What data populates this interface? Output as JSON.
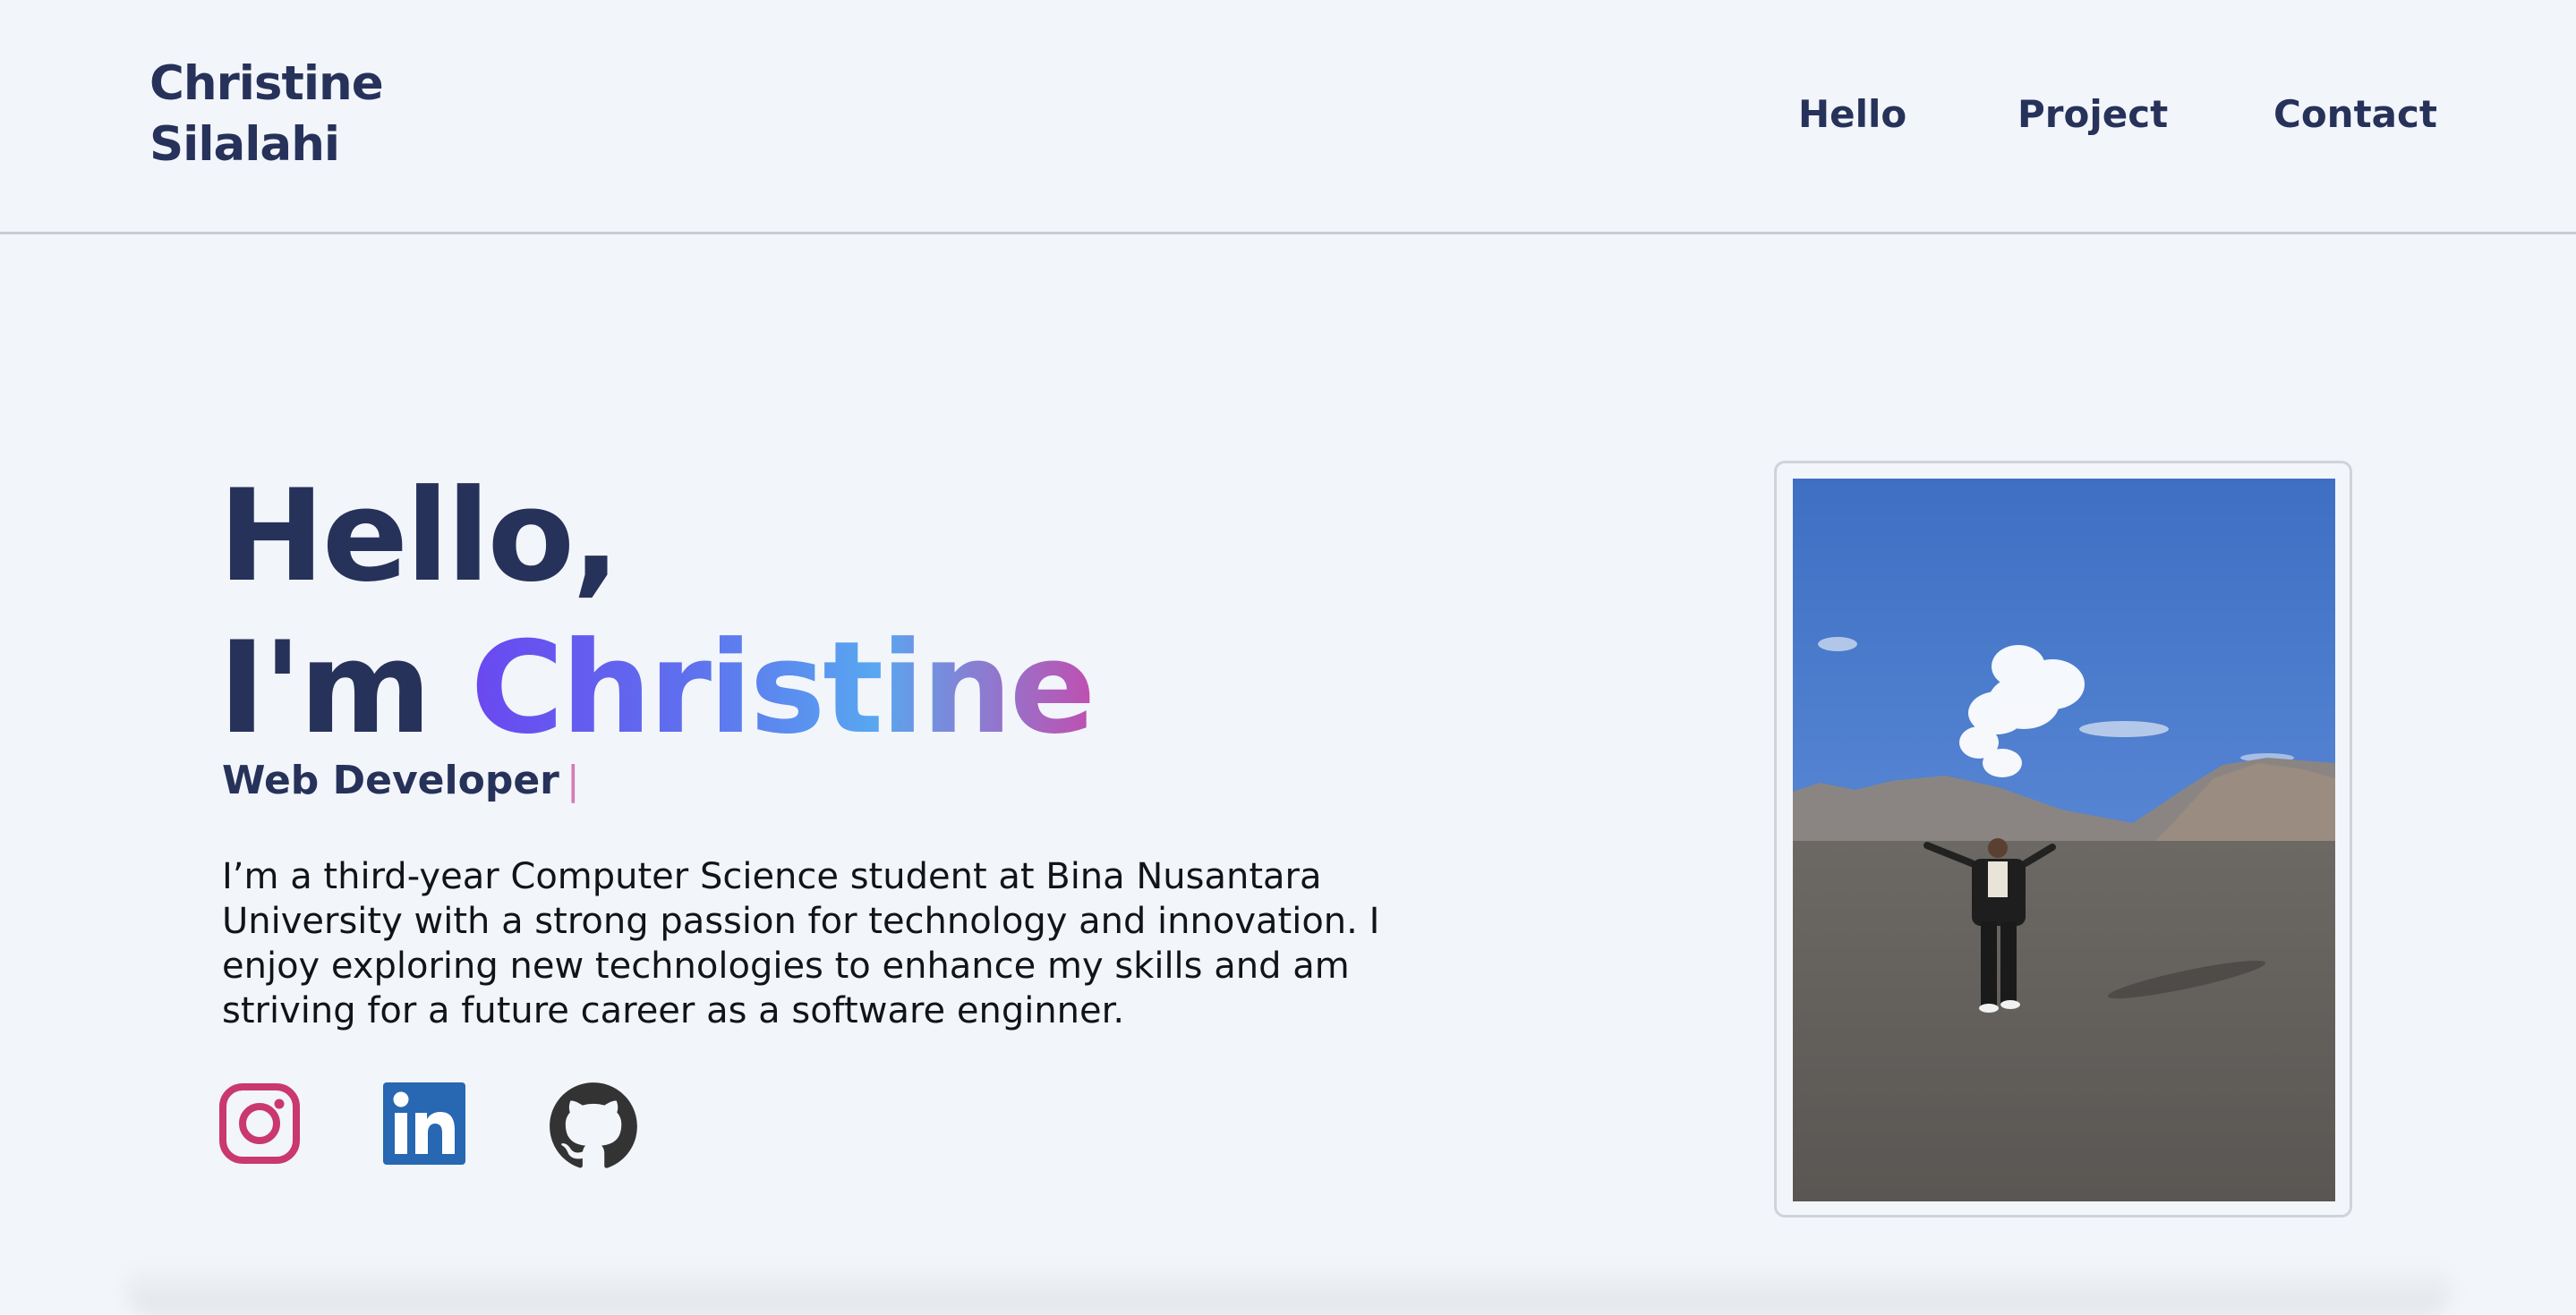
{
  "header": {
    "brand_line1": "Christine",
    "brand_line2": "Silalahi",
    "nav": [
      "Hello",
      "Project",
      "Contact"
    ]
  },
  "hero": {
    "greeting": "Hello,",
    "intro_prefix": "I'm",
    "name": "Christine",
    "role": "Web Developer",
    "cursor": "|",
    "bio": "I’m a third-year Computer Science student at Bina Nusantara University with a strong passion for technology and innovation. I enjoy exploring new technologies to enhance my skills and am striving for a future career as a software enginner."
  },
  "socials": [
    {
      "icon": "instagram-icon",
      "color": "#c9386e"
    },
    {
      "icon": "linkedin-icon",
      "color": "#2867b2"
    },
    {
      "icon": "github-icon",
      "color": "#333333"
    }
  ],
  "colors": {
    "background": "#f2f5fa",
    "text_dark": "#27325a",
    "gradient": [
      "#6a48f0",
      "#58a7f0",
      "#c04fb0"
    ]
  }
}
